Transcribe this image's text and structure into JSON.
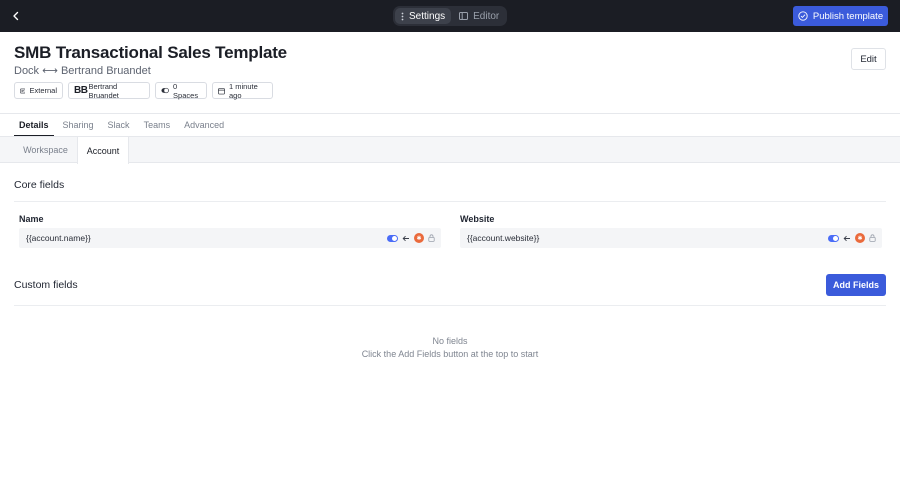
{
  "topbar": {
    "tabs": [
      {
        "label": "Settings",
        "icon": "kebab-icon",
        "active": true
      },
      {
        "label": "Editor",
        "icon": "panel-icon",
        "active": false
      }
    ],
    "publish_label": "Publish template",
    "accent_color": "#3b5bdb"
  },
  "header": {
    "title": "SMB Transactional Sales Template",
    "subtitle": "Dock ⟷ Bertrand Bruandet",
    "edit_label": "Edit",
    "chips": {
      "external": "External",
      "bb_initials": "BB",
      "bb_name": "Bertrand Bruandet",
      "spaces": "0 Spaces",
      "time": "1 minute ago"
    }
  },
  "tabs": [
    "Details",
    "Sharing",
    "Slack",
    "Teams",
    "Advanced"
  ],
  "subtabs": [
    "Workspace",
    "Account"
  ],
  "core": {
    "title": "Core fields",
    "fields": [
      {
        "label": "Name",
        "value": "{{account.name}}"
      },
      {
        "label": "Website",
        "value": "{{account.website}}"
      }
    ]
  },
  "custom": {
    "title": "Custom fields",
    "add_label": "Add Fields",
    "empty_title": "No fields",
    "empty_hint": "Click the Add Fields button at the top to start"
  }
}
